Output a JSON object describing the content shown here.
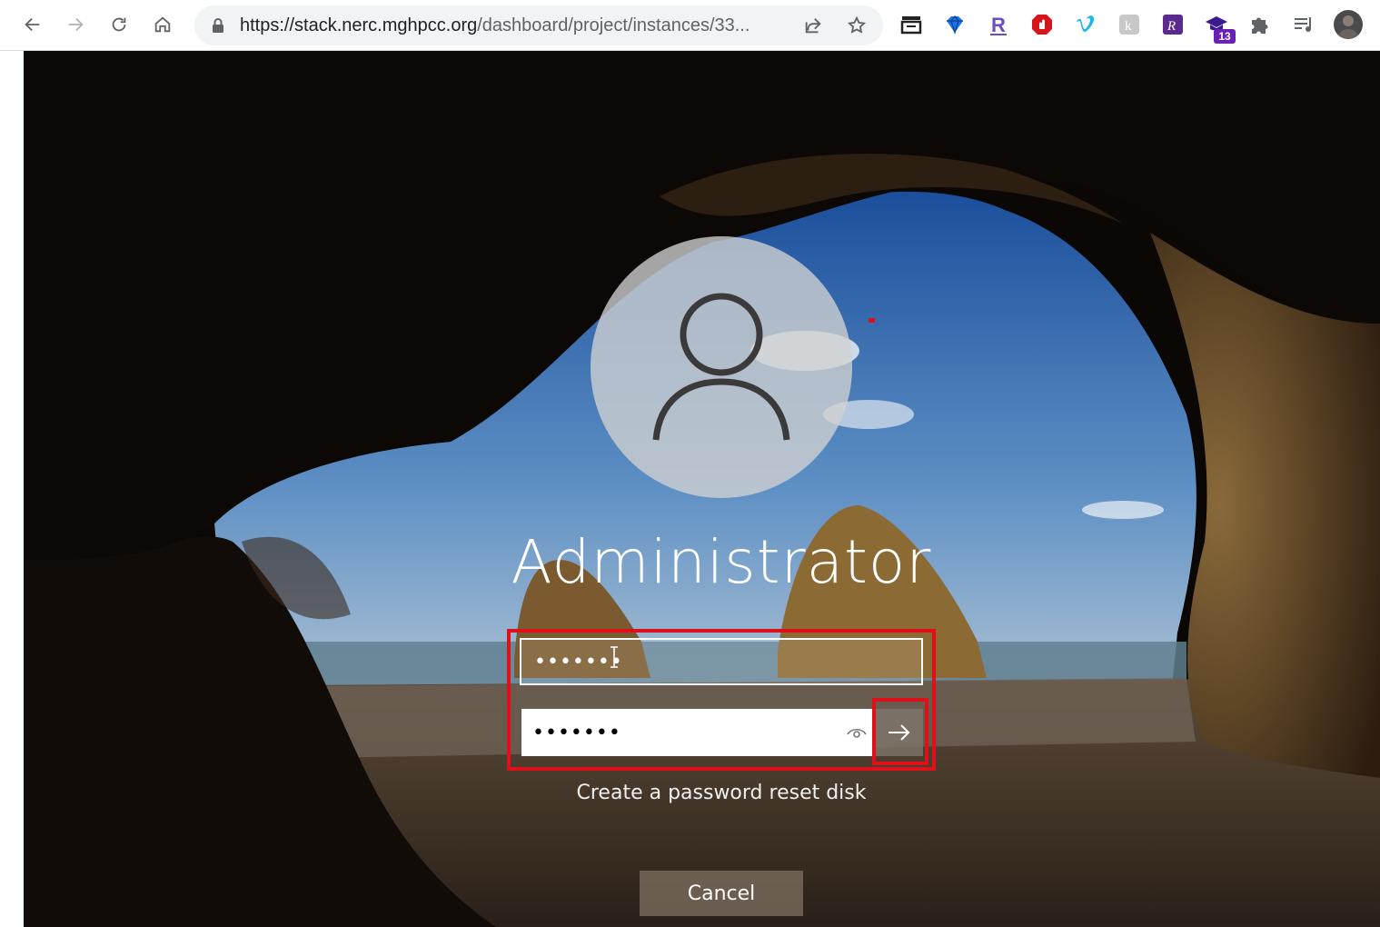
{
  "browser": {
    "url_host": "https://stack.nerc.mghpcc.org",
    "url_path": "/dashboard/project/instances/33...",
    "nav": [
      "back-icon",
      "forward-icon",
      "reload-icon",
      "home-icon"
    ],
    "extension_badge": "13",
    "extensions": [
      "save-icon",
      "gem-icon",
      "r-extension-icon",
      "adblock-icon",
      "vimeo-icon",
      "k-extension-icon",
      "rx-extension-icon",
      "graduation-cap-icon",
      "puzzle-icon",
      "media-queue-icon",
      "profile-avatar-icon"
    ]
  },
  "login": {
    "user_name": "Administrator",
    "field_top_value": "•••••••",
    "field_bottom_value": "•••••••",
    "reset_link": "Create a password reset disk",
    "cancel_label": "Cancel"
  },
  "colors": {
    "highlight": "#e0101a",
    "field_bg": "#ffffff",
    "button_bg": "#827872"
  }
}
